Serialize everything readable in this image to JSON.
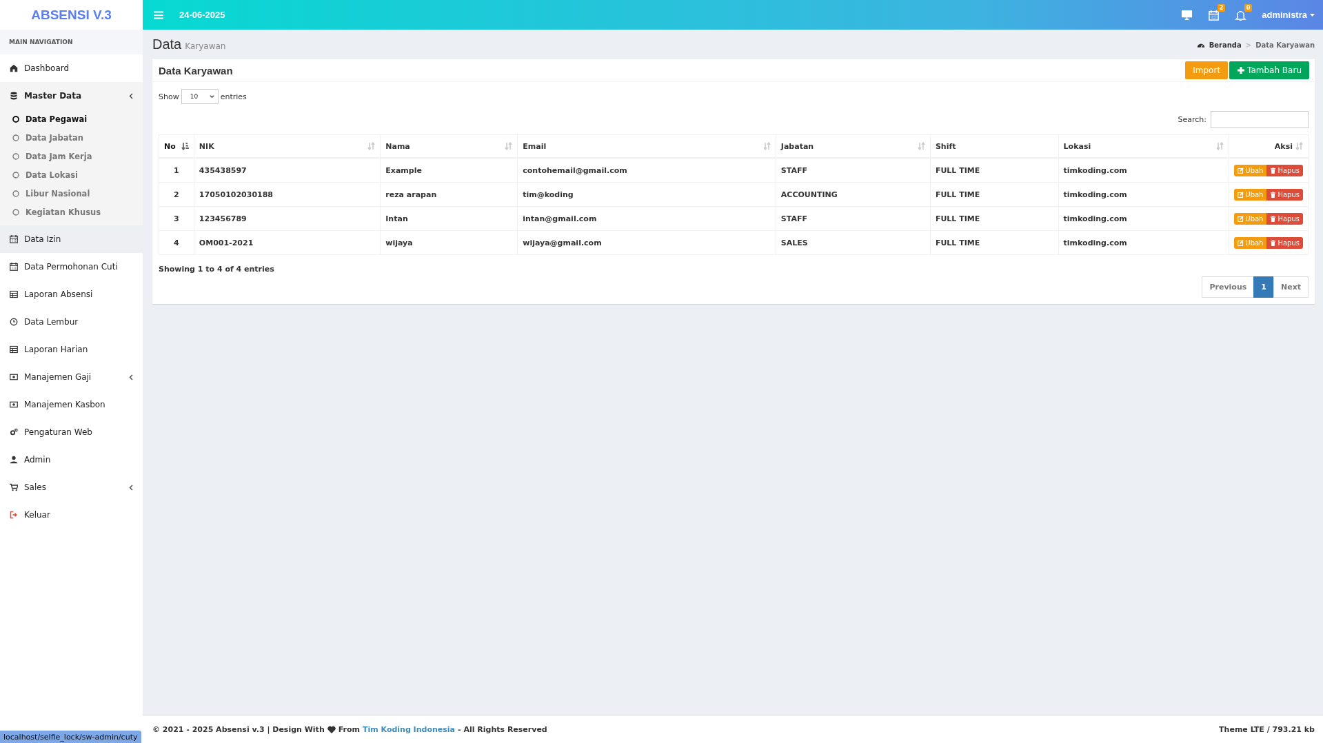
{
  "brand": "ABSENSI V.3",
  "header": {
    "date": "24-06-2025",
    "badges": [
      {
        "count": "2"
      },
      {
        "count": "0"
      }
    ],
    "user": "administra"
  },
  "sidebar": {
    "heading": "MAIN NAVIGATION",
    "items": [
      {
        "label": "Dashboard",
        "selected": false,
        "hovered": false
      },
      {
        "label": "Master Data",
        "selected": true,
        "hovered": false,
        "kind": "tree",
        "children": [
          {
            "label": "Data Pegawai",
            "selected": true
          },
          {
            "label": "Data Jabatan",
            "selected": false
          },
          {
            "label": "Data Jam Kerja",
            "selected": false
          },
          {
            "label": "Data Lokasi",
            "selected": false
          },
          {
            "label": "Libur Nasional",
            "selected": false
          },
          {
            "label": "Kegiatan Khusus",
            "selected": false
          }
        ]
      },
      {
        "label": "Data Izin",
        "selected": false,
        "hovered": true
      },
      {
        "label": "Data Permohonan Cuti",
        "selected": false,
        "hovered": false
      },
      {
        "label": "Laporan Absensi",
        "selected": false,
        "hovered": false
      },
      {
        "label": "Data Lembur",
        "selected": false,
        "hovered": false
      },
      {
        "label": "Laporan Harian",
        "selected": false,
        "hovered": false
      },
      {
        "label": "Manajemen Gaji",
        "selected": false,
        "hovered": false,
        "kind": "tree"
      },
      {
        "label": "Manajemen Kasbon",
        "selected": false,
        "hovered": false
      },
      {
        "label": "Pengaturan Web",
        "selected": false,
        "hovered": false
      },
      {
        "label": "Admin",
        "selected": false,
        "hovered": false
      },
      {
        "label": "Sales",
        "selected": false,
        "hovered": false,
        "kind": "tree"
      },
      {
        "label": "Keluar",
        "selected": false,
        "hovered": false
      }
    ]
  },
  "page": {
    "title": "Data",
    "subtitle": "Karyawan",
    "breadcrumb": [
      "Beranda",
      "Data Karyawan"
    ],
    "breadcrumb_separator": ">"
  },
  "box": {
    "title": "Data Karyawan",
    "buttons": [
      {
        "kind": "warning",
        "label": "Import"
      },
      {
        "kind": "success",
        "label": "Tambah Baru"
      }
    ],
    "show_label": "Show",
    "page_size": "10",
    "entries_label": "entries",
    "search_label": "Search:",
    "table": {
      "columns": [
        {
          "label": "No",
          "sortable": true,
          "sorted": true
        },
        {
          "label": "NIK",
          "sortable": true,
          "sorted": false
        },
        {
          "label": "Nama",
          "sortable": true,
          "sorted": false
        },
        {
          "label": "Email",
          "sortable": true,
          "sorted": false
        },
        {
          "label": "Jabatan",
          "sortable": true,
          "sorted": false
        },
        {
          "label": "Shift",
          "sortable": false,
          "sorted": false
        },
        {
          "label": "Lokasi",
          "sortable": true,
          "sorted": false
        },
        {
          "label": "Aksi",
          "sortable": true,
          "sorted": false
        }
      ],
      "rows": [
        {
          "cells": [
            "1",
            "435438597",
            "Example",
            "contohemail@gmail.com",
            "STAFF",
            "FULL TIME",
            "timkoding.com"
          ],
          "actions": [
            "Ubah",
            "Hapus"
          ]
        },
        {
          "cells": [
            "2",
            "17050102030188",
            "reza arapan",
            "tim@koding",
            "ACCOUNTING",
            "FULL TIME",
            "timkoding.com"
          ],
          "actions": [
            "Ubah",
            "Hapus"
          ]
        },
        {
          "cells": [
            "3",
            "123456789",
            "Intan",
            "intan@gmail.com",
            "STAFF",
            "FULL TIME",
            "timkoding.com"
          ],
          "actions": [
            "Ubah",
            "Hapus"
          ]
        },
        {
          "cells": [
            "4",
            "OM001-2021",
            "wijaya",
            "wijaya@gmail.com",
            "SALES",
            "FULL TIME",
            "timkoding.com"
          ],
          "actions": [
            "Ubah",
            "Hapus"
          ]
        }
      ]
    },
    "info": "Showing 1 to 4 of 4 entries",
    "pagination": [
      {
        "label": "Previous",
        "selected": false
      },
      {
        "label": "1",
        "selected": true
      },
      {
        "label": "Next",
        "selected": false
      }
    ]
  },
  "footer": {
    "left_before": "© 2021 - 2025 Absensi v.3 | Design With",
    "left_from": "From",
    "link": "Tim Koding Indonesia",
    "left_after": "- All Rights Reserved",
    "right": "Theme LTE / 793.21 kb"
  },
  "status_url": "localhost/selfie_lock/sw-admin/cuty"
}
